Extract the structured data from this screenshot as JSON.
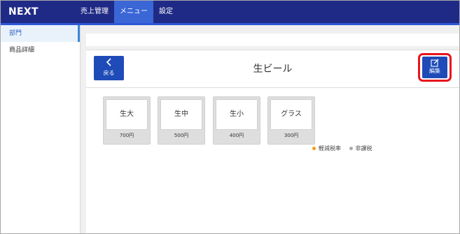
{
  "app": {
    "brand": "NEXT"
  },
  "nav": {
    "items": [
      {
        "label": "売上管理",
        "active": false
      },
      {
        "label": "メニュー",
        "active": true
      },
      {
        "label": "設定",
        "active": false
      }
    ]
  },
  "sidebar": {
    "items": [
      {
        "label": "部門",
        "active": true
      },
      {
        "label": "商品詳細",
        "active": false
      }
    ]
  },
  "toolbar": {
    "back_label": "戻る",
    "back_icon": "chevron-left-icon",
    "edit_label": "編集",
    "edit_icon": "edit-icon"
  },
  "page": {
    "title": "生ビール"
  },
  "products": [
    {
      "name": "生大",
      "price": "700円"
    },
    {
      "name": "生中",
      "price": "500円"
    },
    {
      "name": "生小",
      "price": "400円"
    },
    {
      "name": "グラス",
      "price": "300円"
    }
  ],
  "legend": {
    "items": [
      {
        "label": "軽減税率",
        "color": "#f39c19"
      },
      {
        "label": "非課税",
        "color": "#aaaaaa"
      }
    ]
  },
  "colors": {
    "topbar": "#1f2a86",
    "accent": "#2d57d8",
    "button": "#1f4bb8",
    "highlight": "#e8141e"
  }
}
